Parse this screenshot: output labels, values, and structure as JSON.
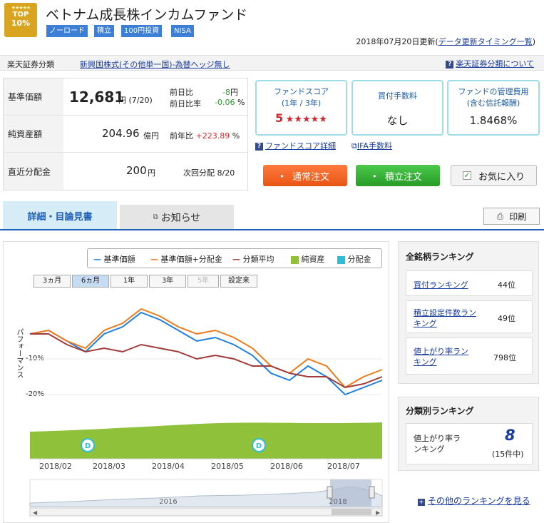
{
  "badge": {
    "stars": "★★★★★",
    "top": "TOP",
    "pct": "10%"
  },
  "fund_title": "ベトナム成長株インカムファンド",
  "tags": [
    "ノーロード",
    "積立",
    "100円投資",
    "NISA"
  ],
  "updated": {
    "date": "2018年07月20日更新",
    "link": "データ更新タイミング一覧"
  },
  "classification": {
    "label": "楽天証券分類",
    "value": "新興国株式(その他単一国)-為替ヘッジ無し",
    "about": "楽天証券分類について"
  },
  "price": {
    "nav_label": "基準価額",
    "nav_value": "12,681",
    "nav_unit": "円",
    "nav_date": "(7/20)",
    "day_change_label": "前日比",
    "day_change": "-8",
    "day_change_unit": "円",
    "day_rate_label": "前日比率",
    "day_rate": "-0.06",
    "pct": "%",
    "assets_label": "純資産額",
    "assets_value": "204.96",
    "assets_unit": "億円",
    "year_change_label": "前年比",
    "year_change": "+223.89",
    "dist_label": "直近分配金",
    "dist_value": "200",
    "dist_unit": "円",
    "next_dist_label": "次回分配",
    "next_dist": "8/20"
  },
  "score": {
    "label": "ファンドスコア",
    "sub": "(1年 / 3年)",
    "value": "5",
    "stars": "★★★★★",
    "detail_link": "ファンドスコア詳細"
  },
  "fee": {
    "label": "買付手数料",
    "value": "なし",
    "ifa_link": "IFA手数料"
  },
  "mgmt": {
    "label": "ファンドの管理費用",
    "sub": "(含む信託報酬)",
    "value": "1.8468%"
  },
  "buttons": {
    "normal": "通常注文",
    "tsumitate": "積立注文",
    "favorite": "お気に入り",
    "print": "印刷"
  },
  "tabs": {
    "detail": "詳細・目論見書",
    "notice": "お知らせ"
  },
  "periods": [
    "3ヵ月",
    "6ヵ月",
    "1年",
    "3年",
    "5年",
    "設定来"
  ],
  "legend": [
    "基準価額",
    "基準価額+分配金",
    "分類平均",
    "純資産",
    "分配金"
  ],
  "colors": {
    "nav": "#1f7fe0",
    "nav_div": "#f07a1a",
    "cat_avg": "#a23b3b",
    "assets": "#8fc23a",
    "dist": "#2ebcd8",
    "accent": "#2160b8"
  },
  "chart_data": {
    "type": "line",
    "ylabel": "パフォーマンス",
    "y_ticks": [
      "-10%",
      "-20%"
    ],
    "x_ticks": [
      "2018/02",
      "2018/03",
      "2018/04",
      "2018/05",
      "2018/06",
      "2018/07"
    ],
    "series": [
      {
        "name": "基準価額",
        "values": [
          -3,
          -2,
          -5,
          -8,
          -3,
          -1,
          3,
          1,
          -2,
          -5,
          -4,
          -6,
          -9,
          -14,
          -16,
          -12,
          -15,
          -20,
          -18,
          -16
        ]
      },
      {
        "name": "基準価額+分配金",
        "values": [
          -3,
          -2,
          -5,
          -7,
          -2,
          0,
          4,
          2,
          -1,
          -3,
          -2,
          -4,
          -7,
          -12,
          -14,
          -10,
          -12,
          -18,
          -15,
          -13
        ]
      },
      {
        "name": "分類平均",
        "values": [
          -3,
          -3,
          -6,
          -8,
          -7,
          -8,
          -6,
          -7,
          -8,
          -10,
          -9,
          -10,
          -12,
          -12,
          -14,
          -15,
          -15,
          -18,
          -17,
          -15
        ]
      }
    ],
    "distribution_marker": "D",
    "navigator_year_labels": [
      "2016",
      "2018"
    ]
  },
  "ranking": {
    "all_title": "全銘柄ランキング",
    "rows": [
      {
        "label": "買付ランキング",
        "value": "44位"
      },
      {
        "label": "積立設定件数ランキング",
        "value": "49位"
      },
      {
        "label": "値上がり率ランキング",
        "value": "798位"
      }
    ],
    "cat_title": "分類別ランキング",
    "cat_label": "値上がり率ランキング",
    "cat_value": "8",
    "cat_total": "(15件中)",
    "more_link": "その他のランキングを見る"
  }
}
